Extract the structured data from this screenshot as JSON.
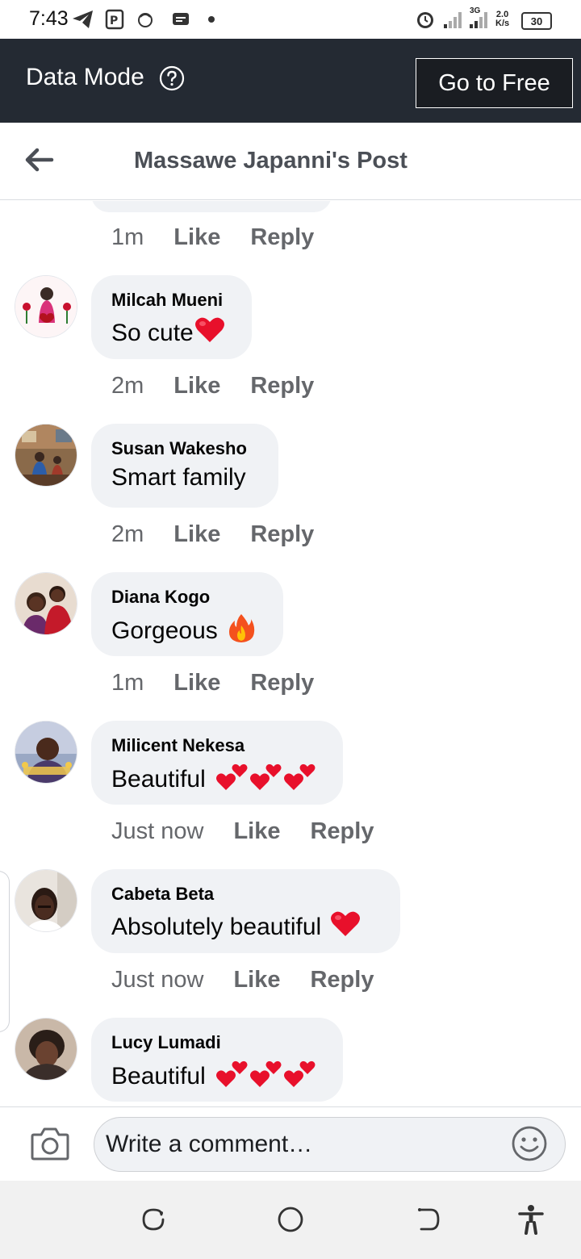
{
  "status_bar": {
    "time": "7:43",
    "network_label": "3G",
    "speed_value": "2.0",
    "speed_unit": "K/s",
    "battery": "30"
  },
  "data_mode": {
    "label": "Data Mode",
    "go_free": "Go to Free"
  },
  "header": {
    "title": "Massawe Japanni's Post"
  },
  "top_partial": {
    "time": "1m",
    "like": "Like",
    "reply": "Reply"
  },
  "comments": [
    {
      "author": "Milcah Mueni",
      "text": "So cute",
      "emoji": "red-heart",
      "time": "2m",
      "like": "Like",
      "reply": "Reply"
    },
    {
      "author": "Susan Wakesho",
      "text": "Smart family",
      "emoji": "",
      "time": "2m",
      "like": "Like",
      "reply": "Reply"
    },
    {
      "author": "Diana Kogo",
      "text": "Gorgeous",
      "emoji": "fire",
      "time": "1m",
      "like": "Like",
      "reply": "Reply"
    },
    {
      "author": "Milicent Nekesa",
      "text": "Beautiful",
      "emoji": "two-hearts x3",
      "time": "Just now",
      "like": "Like",
      "reply": "Reply"
    },
    {
      "author": "Cabeta Beta",
      "text": "Absolutely beautiful",
      "emoji": "red-heart",
      "time": "Just now",
      "like": "Like",
      "reply": "Reply"
    },
    {
      "author": "Lucy Lumadi",
      "text": "Beautiful",
      "emoji": "two-hearts x3",
      "time": "",
      "like": "",
      "reply": ""
    }
  ],
  "composer": {
    "placeholder": "Write a comment…"
  },
  "colors": {
    "data_bar": "#242a33",
    "bubble": "#f0f2f5",
    "meta_text": "#65676b",
    "heart": "#e8102b"
  }
}
